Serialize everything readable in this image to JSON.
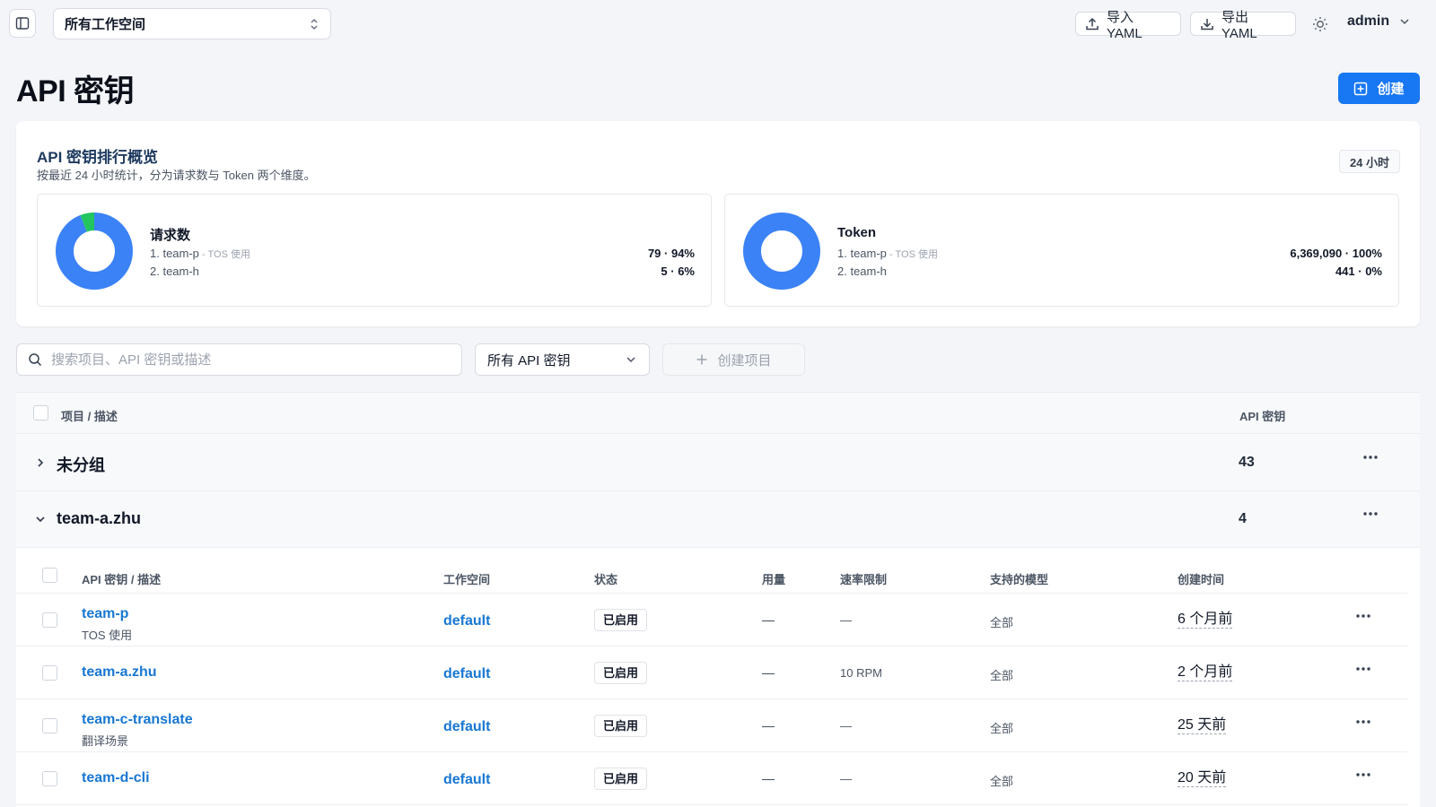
{
  "topbar": {
    "workspace": "所有工作空间",
    "import_label": "导入 YAML",
    "export_label": "导出 YAML",
    "user": "admin"
  },
  "page": {
    "title": "API 密钥",
    "create_label": "创建"
  },
  "overview": {
    "title": "API 密钥排行概览",
    "subtitle": "按最近 24 小时统计，分为请求数与 Token 两个维度。",
    "period": "24 小时",
    "requests": {
      "name": "请求数",
      "items": [
        {
          "rank": "1. team-p",
          "sub": " - TOS 使用",
          "value": "79 · 94%",
          "share": 0.94,
          "color": "#3b82f6"
        },
        {
          "rank": "2. team-h",
          "sub": "",
          "value": "5 · 6%",
          "share": 0.06,
          "color": "#22c55e"
        }
      ]
    },
    "tokens": {
      "name": "Token",
      "items": [
        {
          "rank": "1. team-p",
          "sub": " - TOS 使用",
          "value": "6,369,090 · 100%",
          "share": 1.0,
          "color": "#3b82f6"
        },
        {
          "rank": "2. team-h",
          "sub": "",
          "value": "441 · 0%",
          "share": 0.0,
          "color": "#22c55e"
        }
      ]
    }
  },
  "filters": {
    "search_placeholder": "搜索项目、API 密钥或描述",
    "key_filter": "所有 API 密钥",
    "create_project": "创建项目"
  },
  "table": {
    "col_project": "项目 / 描述",
    "col_keys": "API 密钥",
    "groups": [
      {
        "name": "未分组",
        "count": "43",
        "expanded": false
      },
      {
        "name": "team-a.zhu",
        "count": "4",
        "expanded": true
      }
    ],
    "inner_cols": {
      "key": "API 密钥 / 描述",
      "workspace": "工作空间",
      "status": "状态",
      "usage": "用量",
      "rate": "速率限制",
      "models": "支持的模型",
      "created": "创建时间"
    },
    "rows": [
      {
        "name": "team-p",
        "desc": "TOS 使用",
        "workspace": "default",
        "status": "已启用",
        "usage": "—",
        "rate": "—",
        "models": "全部",
        "created": "6 个月前"
      },
      {
        "name": "team-a.zhu",
        "desc": "",
        "workspace": "default",
        "status": "已启用",
        "usage": "—",
        "rate": "10 RPM",
        "models": "全部",
        "created": "2 个月前"
      },
      {
        "name": "team-c-translate",
        "desc": "翻译场景",
        "workspace": "default",
        "status": "已启用",
        "usage": "—",
        "rate": "—",
        "models": "全部",
        "created": "25 天前"
      },
      {
        "name": "team-d-cli",
        "desc": "",
        "workspace": "default",
        "status": "已启用",
        "usage": "—",
        "rate": "—",
        "models": "全部",
        "created": "20 天前"
      }
    ]
  },
  "colors": {
    "accent": "#1877f2",
    "link": "#1877d2",
    "donut_primary": "#3b82f6",
    "donut_secondary": "#22c55e"
  }
}
